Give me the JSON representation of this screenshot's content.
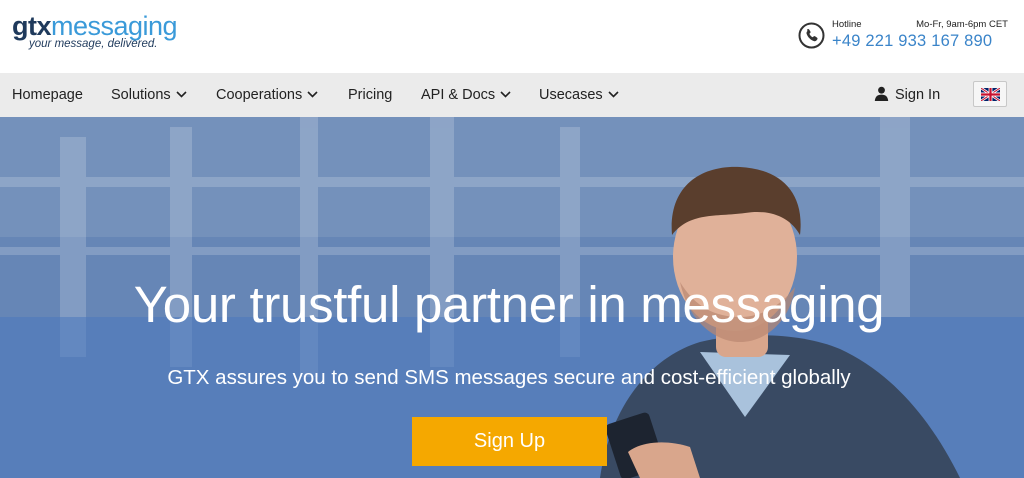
{
  "header": {
    "logo": {
      "gtx": "gtx",
      "messaging": "messaging",
      "tagline": "your message, delivered."
    },
    "hotline": {
      "label": "Hotline",
      "hours": "Mo-Fr, 9am-6pm CET",
      "number": "+49 221 933 167 890",
      "icon": "phone-icon"
    }
  },
  "nav": {
    "items": [
      {
        "label": "Homepage",
        "has_dropdown": false
      },
      {
        "label": "Solutions",
        "has_dropdown": true
      },
      {
        "label": "Cooperations",
        "has_dropdown": true
      },
      {
        "label": "Pricing",
        "has_dropdown": false
      },
      {
        "label": "API & Docs",
        "has_dropdown": true
      },
      {
        "label": "Usecases",
        "has_dropdown": true
      }
    ],
    "signin_label": "Sign In",
    "signin_icon": "user-icon",
    "language_icon": "uk-flag-icon"
  },
  "hero": {
    "title": "Your trustful partner in messaging",
    "subtitle": "GTX assures you to send SMS messages secure and cost-efficient globally",
    "cta_label": "Sign Up",
    "cta_color": "#f5a800"
  },
  "colors": {
    "brand_dark": "#1f3a5c",
    "brand_light": "#3a9ad9",
    "nav_bg": "#ebebeb",
    "hotline_number": "#3a84c9"
  }
}
